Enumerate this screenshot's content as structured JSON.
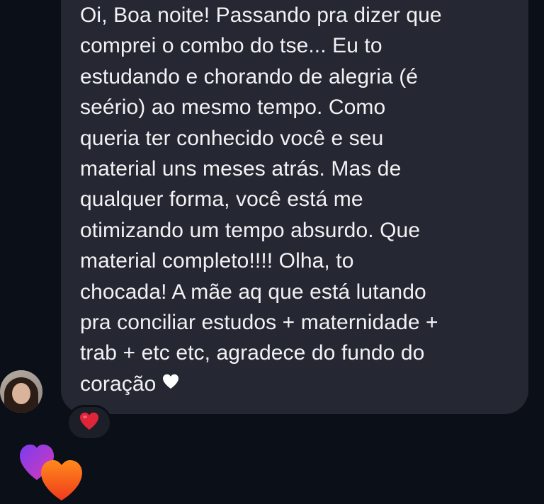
{
  "message": {
    "lines": [
      "Oi, Boa noite! Passando pra dizer que",
      "comprei o combo do tse... Eu to",
      "estudando e chorando de alegria (é",
      "seério) ao mesmo tempo. Como",
      "queria ter conhecido você e seu",
      "material uns meses atrás. Mas de",
      "qualquer forma, você está me",
      "otimizando um tempo absurdo. Que",
      "material completo!!!! Olha, to",
      "chocada! A mãe aq que está lutando",
      "pra conciliar estudos + maternidade +",
      "trab + etc etc, agradece do fundo do",
      "coração"
    ],
    "trailing_emoji": "white-heart-icon"
  },
  "reaction": {
    "emoji": "red-heart-icon"
  },
  "floating_hearts": [
    "purple-heart-icon",
    "orange-heart-icon"
  ],
  "colors": {
    "background": "#0b0f17",
    "bubble": "#252832",
    "text": "#f2f2f5",
    "red_heart": "#e0243a",
    "purple_heart": "#b23ad6",
    "orange_heart": "#f2561d"
  }
}
